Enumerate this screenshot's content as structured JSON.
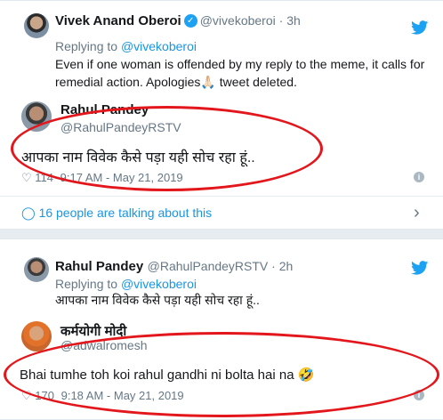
{
  "card1": {
    "tweet": {
      "author_name": "Vivek Anand Oberoi",
      "author_handle": "@vivekoberoi",
      "time": "3h",
      "replying_prefix": "Replying to",
      "replying_handle": "@vivekoberoi",
      "text": "Even if one woman is offended by my reply to the meme, it calls for remedial action. Apologies🙏🏻 tweet deleted."
    },
    "quoted": {
      "author_name": "Rahul Pandey",
      "author_handle": "@RahulPandeyRSTV",
      "text": "आपका नाम विवेक कैसे पड़ा यही सोच रहा हूं..",
      "likes": "114",
      "timestamp": "9:17 AM - May 21, 2019"
    },
    "talking": "16 people are talking about this"
  },
  "card2": {
    "tweet": {
      "author_name": "Rahul Pandey",
      "author_handle": "@RahulPandeyRSTV",
      "time": "2h",
      "replying_prefix": "Replying to",
      "replying_handle": "@vivekoberoi",
      "text": "आपका नाम विवेक कैसे पड़ा यही सोच रहा हूं.."
    },
    "quoted": {
      "author_name": "कर्मयोगी मोदी",
      "author_handle": "@adwalromesh",
      "text": "Bhai tumhe toh koi rahul gandhi ni bolta hai na 🤣",
      "likes": "170",
      "timestamp": "9:18 AM - May 21, 2019"
    }
  },
  "colors": {
    "twitter_blue": "#1da1f2",
    "link": "#1b95e0",
    "annotation_red": "#e3161b",
    "muted": "#657786"
  }
}
